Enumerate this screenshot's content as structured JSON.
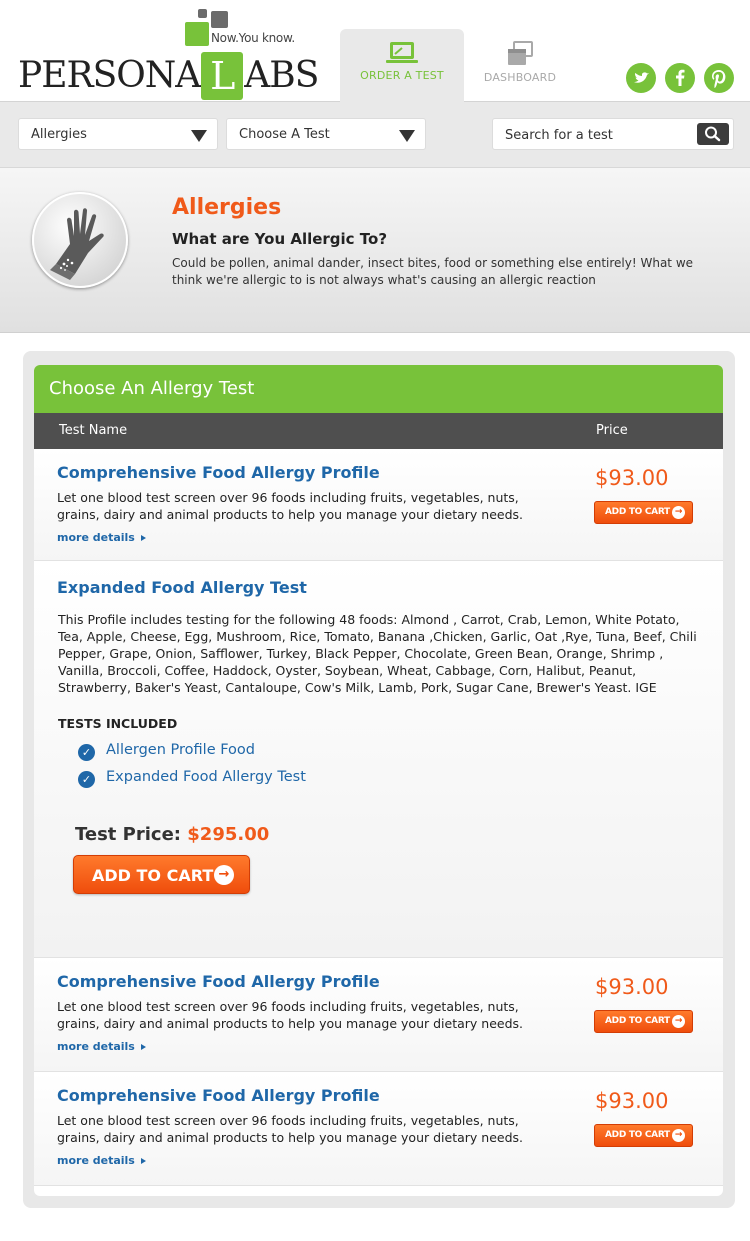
{
  "brand": {
    "tagline": "Now.You know.",
    "name_before": "PERSONA",
    "name_letter": "L",
    "name_after": "ABS",
    "accent": "#78c23a",
    "orange": "#f05a1a",
    "link_blue": "#1f67a8"
  },
  "nav": {
    "tabs": [
      {
        "label": "ORDER A TEST",
        "icon": "laptop-icon",
        "active": true
      },
      {
        "label": "DASHBOARD",
        "icon": "windows-stack-icon",
        "active": false
      }
    ],
    "social": [
      {
        "name": "twitter",
        "glyph": "t"
      },
      {
        "name": "facebook",
        "glyph": "f"
      },
      {
        "name": "pinterest",
        "glyph": "p"
      }
    ]
  },
  "filters": {
    "category": "Allergies",
    "test": "Choose A Test",
    "search_placeholder": "Search for a test"
  },
  "category": {
    "title": "Allergies",
    "subtitle": "What are You Allergic To?",
    "description": "Could be pollen, animal dander, insect bites, food or something else entirely! What we think we're allergic to is not always what's causing an allergic reaction"
  },
  "panel": {
    "title": "Choose An Allergy Test",
    "col_name": "Test Name",
    "col_price": "Price",
    "more_label": "more details",
    "add_to_cart_small": "ADD TO CART",
    "rows": [
      {
        "title": "Comprehensive Food Allergy Profile",
        "desc": "Let one blood test screen over 96 foods including fruits, vegetables, nuts, grains, dairy and animal products to help you manage your dietary needs.",
        "price": "$93.00"
      },
      {
        "title": "Comprehensive Food Allergy Profile",
        "desc": "Let one blood test screen over 96 foods including fruits, vegetables, nuts, grains, dairy and animal products to help you manage your dietary needs.",
        "price": "$93.00"
      },
      {
        "title": "Comprehensive Food Allergy Profile",
        "desc": "Let one blood test screen over 96 foods including fruits, vegetables, nuts, grains, dairy and animal products to help you manage your dietary needs.",
        "price": "$93.00"
      }
    ],
    "expanded": {
      "title": "Expanded Food Allergy Test",
      "desc": "This Profile includes testing for the following 48 foods: Almond , Carrot, Crab, Lemon, White Potato, Tea, Apple, Cheese, Egg, Mushroom, Rice, Tomato, Banana ,Chicken, Garlic, Oat ,Rye, Tuna, Beef, Chili Pepper, Grape, Onion, Safflower, Turkey, Black Pepper, Chocolate, Green Bean, Orange, Shrimp , Vanilla, Broccoli, Coffee, Haddock, Oyster, Soybean, Wheat, Cabbage, Corn, Halibut, Peanut, Strawberry, Baker's Yeast, Cantaloupe, Cow's Milk, Lamb, Pork, Sugar Cane, Brewer's Yeast. IGE",
      "tests_label": "TESTS INCLUDED",
      "tests": [
        "Allergen Profile Food",
        "Expanded Food Allergy Test"
      ],
      "price_label": "Test Price:",
      "price": "$295.00",
      "cart_label": "ADD TO CART"
    }
  }
}
